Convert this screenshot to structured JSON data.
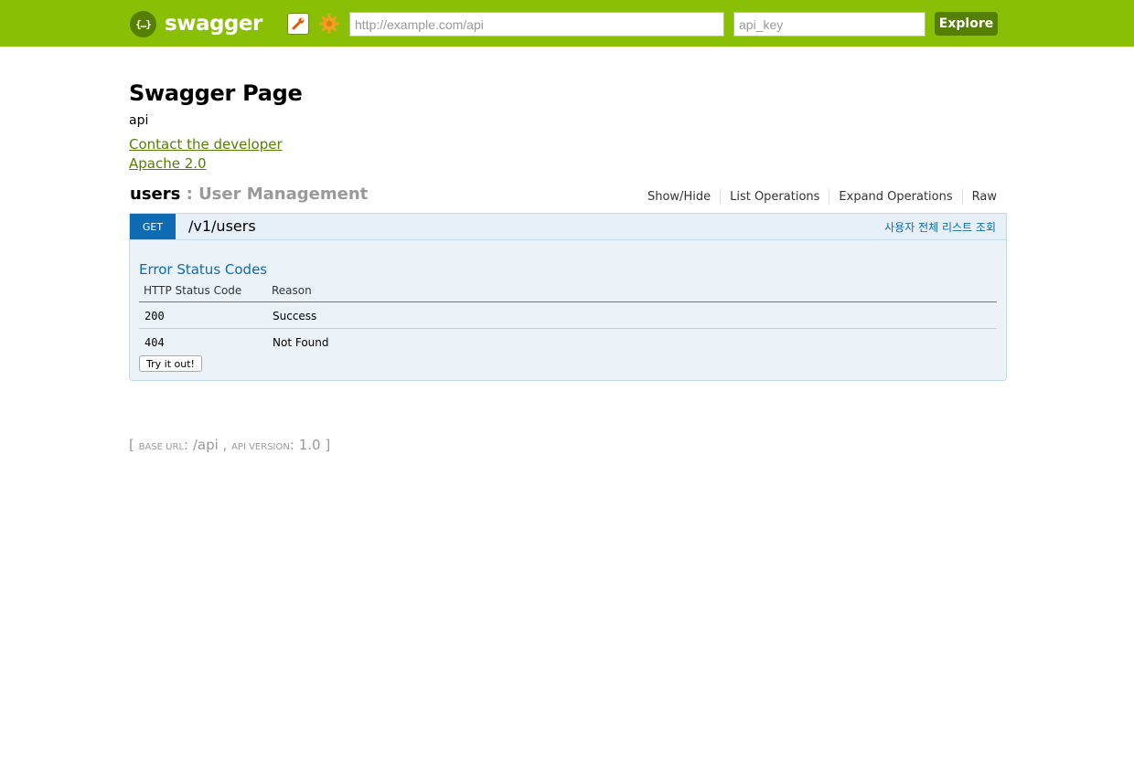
{
  "header": {
    "logo_glyph": "{…}",
    "logo_text": "swagger",
    "url_placeholder": "http://example.com/api",
    "api_key_placeholder": "api_key",
    "explore_label": "Explore",
    "accent_color": "#89bf04",
    "dark_accent_color": "#547f00"
  },
  "info": {
    "title": "Swagger Page",
    "description": "api",
    "contact_label": "Contact the developer",
    "license_label": "Apache 2.0"
  },
  "resource": {
    "name": "users",
    "separator": " : ",
    "description": "User Management",
    "options": [
      "Show/Hide",
      "List Operations",
      "Expand Operations",
      "Raw"
    ]
  },
  "operation": {
    "method": "GET",
    "path": "/v1/users",
    "summary": "사용자 전체 리스트 조회",
    "method_color": "#0f6ab4",
    "error_heading": "Error Status Codes",
    "table": {
      "headers": [
        "HTTP Status Code",
        "Reason"
      ],
      "rows": [
        {
          "code": "200",
          "reason": "Success"
        },
        {
          "code": "404",
          "reason": "Not Found"
        }
      ]
    },
    "try_label": "Try it out!"
  },
  "footer": {
    "open": "[ ",
    "base_url_label": "base url",
    "base_url": "/api",
    "api_version_label": "api version",
    "api_version": "1.0",
    "close": " ]"
  }
}
